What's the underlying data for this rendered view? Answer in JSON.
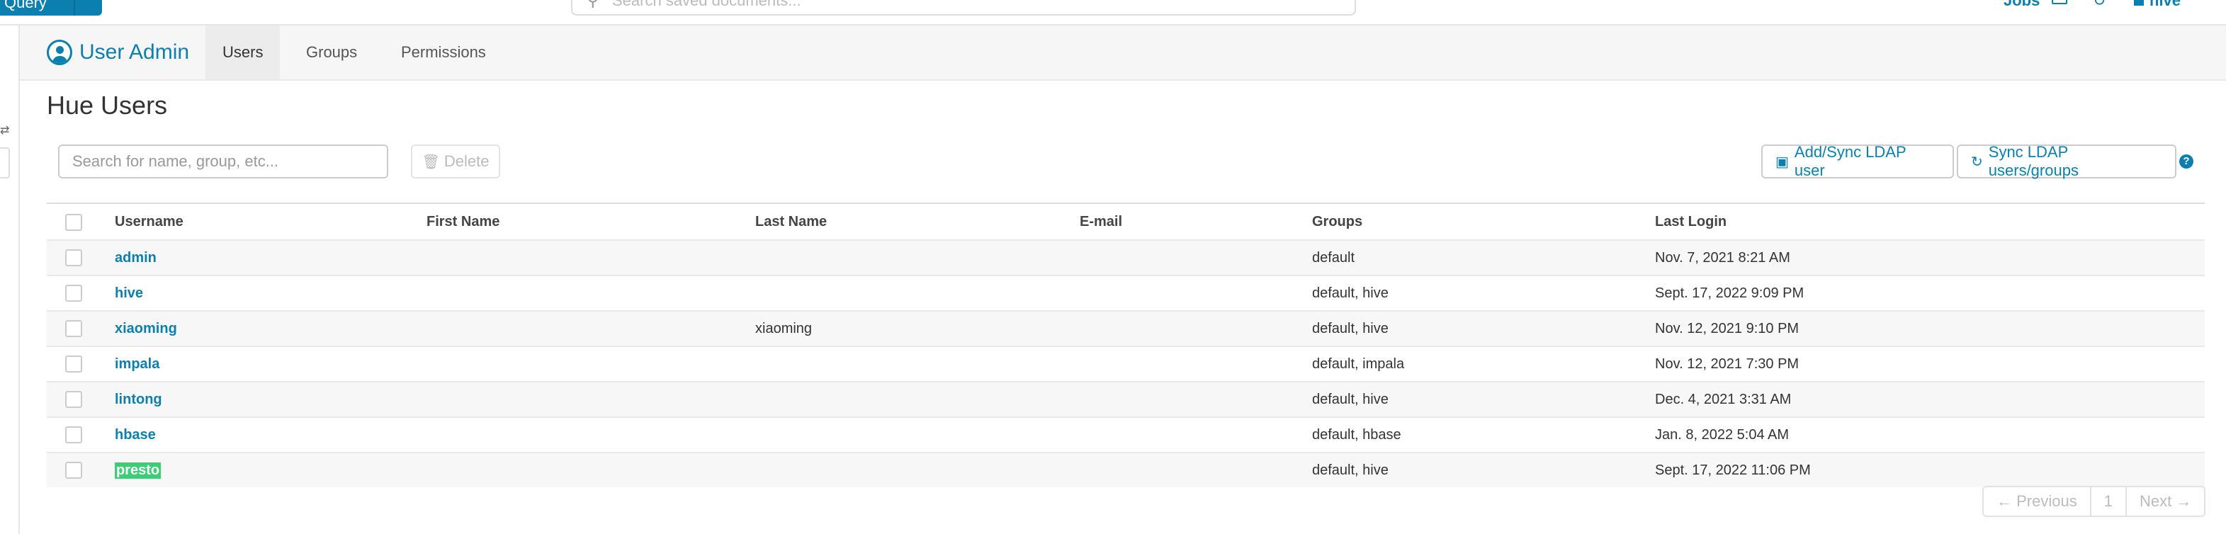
{
  "topbar": {
    "query_label": "Query",
    "search_placeholder": "Search saved documents...",
    "jobs_label": "Jobs",
    "user_label": "hive"
  },
  "app": {
    "title": "User Admin",
    "tabs": [
      {
        "label": "Users",
        "active": true
      },
      {
        "label": "Groups",
        "active": false
      },
      {
        "label": "Permissions",
        "active": false
      }
    ]
  },
  "page": {
    "title": "Hue Users",
    "search_placeholder": "Search for name, group, etc...",
    "delete_label": "Delete",
    "add_sync_label": "Add/Sync LDAP user",
    "sync_label": "Sync LDAP users/groups",
    "help_icon": "question-circle-icon"
  },
  "table": {
    "columns": [
      "Username",
      "First Name",
      "Last Name",
      "E-mail",
      "Groups",
      "Last Login"
    ],
    "rows": [
      {
        "username": "admin",
        "first": "",
        "last": "",
        "email": "",
        "groups": "default",
        "last_login": "Nov. 7, 2021 8:21 AM"
      },
      {
        "username": "hive",
        "first": "",
        "last": "",
        "email": "",
        "groups": "default, hive",
        "last_login": "Sept. 17, 2022 9:09 PM"
      },
      {
        "username": "xiaoming",
        "first": "",
        "last": "xiaoming",
        "email": "",
        "groups": "default, hive",
        "last_login": "Nov. 12, 2021 9:10 PM"
      },
      {
        "username": "impala",
        "first": "",
        "last": "",
        "email": "",
        "groups": "default, impala",
        "last_login": "Nov. 12, 2021 7:30 PM"
      },
      {
        "username": "lintong",
        "first": "",
        "last": "",
        "email": "",
        "groups": "default, hive",
        "last_login": "Dec. 4, 2021 3:31 AM"
      },
      {
        "username": "hbase",
        "first": "",
        "last": "",
        "email": "",
        "groups": "default, hbase",
        "last_login": "Jan. 8, 2022 5:04 AM"
      },
      {
        "username": "presto",
        "first": "",
        "last": "",
        "email": "",
        "groups": "default, hive",
        "last_login": "Sept. 17, 2022 11:06 PM",
        "highlighted": true
      }
    ]
  },
  "pagination": {
    "previous_label": "← Previous",
    "page": "1",
    "next_label": "Next →"
  },
  "colors": {
    "accent": "#0b7fad",
    "highlight": "#3cce76"
  }
}
